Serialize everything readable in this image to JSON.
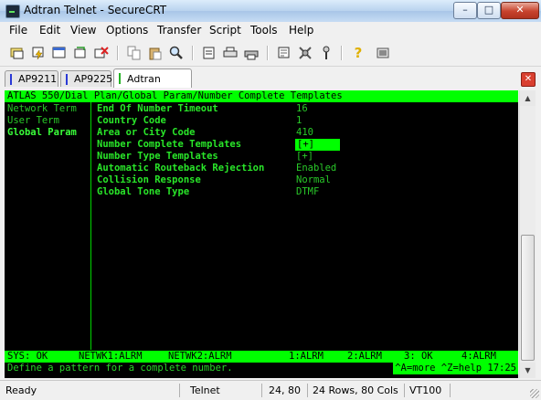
{
  "window": {
    "title": "Adtran Telnet - SecureCRT",
    "minimize": "–",
    "maximize": "□",
    "close": "✕"
  },
  "menu": [
    "File",
    "Edit",
    "View",
    "Options",
    "Transfer",
    "Script",
    "Tools",
    "Help"
  ],
  "toolbar_icons": [
    "connect-icon",
    "quick-connect-icon",
    "connect-in-tab-icon",
    "reconnect-icon",
    "disconnect-icon",
    "copy-icon",
    "paste-icon",
    "find-icon",
    "print-setup-icon",
    "print-icon",
    "log-icon",
    "session-options-icon",
    "global-options-icon",
    "keymap-icon",
    "help-icon",
    "about-icon"
  ],
  "tabs": [
    {
      "label": "AP9211",
      "active": false
    },
    {
      "label": "AP9225",
      "active": false
    },
    {
      "label": "Adtran Telnet",
      "active": true
    }
  ],
  "terminal": {
    "header": "ATLAS 550/Dial Plan/Global Param/Number Complete Templates",
    "nav": [
      "Network Term",
      "User Term",
      "Global Param"
    ],
    "fields": [
      {
        "label": "End Of Number Timeout",
        "value": "16"
      },
      {
        "label": "Country Code",
        "value": "1"
      },
      {
        "label": "Area or City Code",
        "value": "410"
      },
      {
        "label": "Number Complete Templates",
        "value": "[+]"
      },
      {
        "label": "Number Type Templates",
        "value": "[+]"
      },
      {
        "label": "Automatic Routeback Rejection",
        "value": "Enabled"
      },
      {
        "label": "Collision Response",
        "value": "Normal"
      },
      {
        "label": "Global Tone Type",
        "value": "DTMF"
      }
    ],
    "status": [
      "SYS: OK",
      "NETWK1:ALRM",
      "NETWK2:ALRM",
      "1:ALRM",
      "2:ALRM",
      "3: OK",
      "4:ALRM"
    ],
    "prompt": "Define a pattern for a complete number.",
    "help": "^A=more ^Z=help 17:25"
  },
  "statusbar": {
    "state": "Ready",
    "protocol": "Telnet",
    "cursor": "24, 80",
    "size": "24 Rows, 80 Cols",
    "emulation": "VT100"
  },
  "colors": {
    "terminal_bg": "#000000",
    "terminal_fg": "#29c929",
    "highlight": "#00ff00"
  }
}
